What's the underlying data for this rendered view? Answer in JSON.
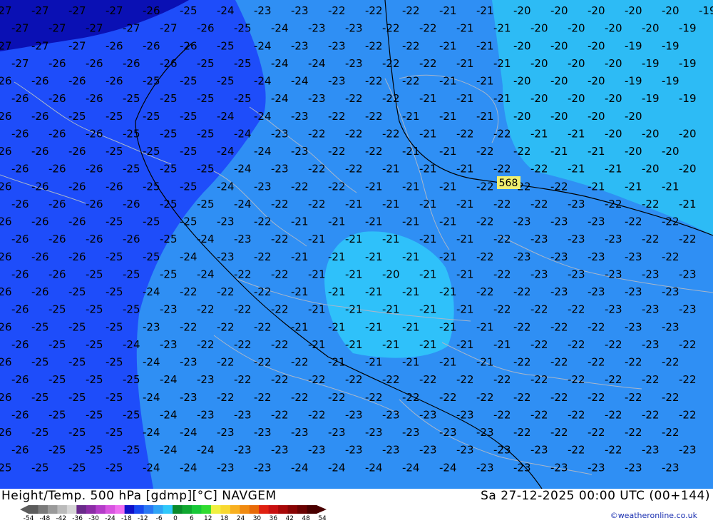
{
  "map": {
    "marker_label": "568",
    "colors": {
      "region_dark": "#0a10b4",
      "region_mid": "#1e4dfa",
      "region_main": "#2f8ff4",
      "region_light": "#2fc1fa",
      "region_light_right": "#2dbbf5",
      "contour": "#000000",
      "border": "#a9b6c9",
      "marker_bg": "#f0f070"
    },
    "temperature_rows": [
      [
        "-27",
        "-27",
        "-27",
        "-27",
        "-26",
        "-25",
        "-24",
        "-23",
        "-23",
        "-22",
        "-22",
        "-22",
        "-21",
        "-21",
        "-20",
        "-20",
        "-20",
        "-20",
        "-20",
        "-19",
        "-19"
      ],
      [
        "-27",
        "-27",
        "-27",
        "-27",
        "-27",
        "-26",
        "-25",
        "-24",
        "-23",
        "-23",
        "-22",
        "-22",
        "-21",
        "-21",
        "-20",
        "-20",
        "-20",
        "-20",
        "-19",
        "-19"
      ],
      [
        "-27",
        "-27",
        "-27",
        "-26",
        "-26",
        "-26",
        "-25",
        "-24",
        "-23",
        "-23",
        "-22",
        "-22",
        "-21",
        "-21",
        "-20",
        "-20",
        "-20",
        "-19",
        "-19"
      ],
      [
        "-27",
        "-26",
        "-26",
        "-26",
        "-26",
        "-25",
        "-25",
        "-24",
        "-24",
        "-23",
        "-22",
        "-22",
        "-21",
        "-21",
        "-20",
        "-20",
        "-20",
        "-19",
        "-19"
      ],
      [
        "-26",
        "-26",
        "-26",
        "-26",
        "-25",
        "-25",
        "-25",
        "-24",
        "-24",
        "-23",
        "-22",
        "-22",
        "-21",
        "-21",
        "-20",
        "-20",
        "-20",
        "-19",
        "-19"
      ],
      [
        "-26",
        "-26",
        "-26",
        "-25",
        "-25",
        "-25",
        "-25",
        "-24",
        "-23",
        "-22",
        "-22",
        "-21",
        "-21",
        "-21",
        "-20",
        "-20",
        "-20",
        "-19",
        "-19"
      ],
      [
        "-26",
        "-26",
        "-25",
        "-25",
        "-25",
        "-25",
        "-24",
        "-24",
        "-23",
        "-22",
        "-22",
        "-21",
        "-21",
        "-21",
        "-20",
        "-20",
        "-20",
        "-20"
      ],
      [
        "-26",
        "-26",
        "-26",
        "-25",
        "-25",
        "-25",
        "-24",
        "-23",
        "-22",
        "-22",
        "-22",
        "-21",
        "-22",
        "-22",
        "-21",
        "-21",
        "-20",
        "-20",
        "-20"
      ],
      [
        "-26",
        "-26",
        "-26",
        "-25",
        "-25",
        "-25",
        "-24",
        "-24",
        "-23",
        "-22",
        "-22",
        "-21",
        "-21",
        "-22",
        "-22",
        "-21",
        "-21",
        "-20",
        "-20"
      ],
      [
        "-26",
        "-26",
        "-26",
        "-25",
        "-25",
        "-25",
        "-24",
        "-23",
        "-22",
        "-22",
        "-21",
        "-21",
        "-21",
        "-22",
        "-22",
        "-21",
        "-21",
        "-20",
        "-20"
      ],
      [
        "-26",
        "-26",
        "-26",
        "-26",
        "-25",
        "-25",
        "-24",
        "-23",
        "-22",
        "-22",
        "-21",
        "-21",
        "-21",
        "-22",
        "-22",
        "-22",
        "-21",
        "-21",
        "-21"
      ],
      [
        "-26",
        "-26",
        "-26",
        "-26",
        "-25",
        "-25",
        "-24",
        "-22",
        "-22",
        "-21",
        "-21",
        "-21",
        "-21",
        "-22",
        "-22",
        "-23",
        "-22",
        "-22",
        "-21"
      ],
      [
        "-26",
        "-26",
        "-26",
        "-25",
        "-25",
        "-25",
        "-23",
        "-22",
        "-21",
        "-21",
        "-21",
        "-21",
        "-21",
        "-22",
        "-23",
        "-23",
        "-23",
        "-22",
        "-22"
      ],
      [
        "-26",
        "-26",
        "-26",
        "-26",
        "-25",
        "-24",
        "-23",
        "-22",
        "-21",
        "-21",
        "-21",
        "-21",
        "-21",
        "-22",
        "-23",
        "-23",
        "-23",
        "-22",
        "-22"
      ],
      [
        "-26",
        "-26",
        "-26",
        "-25",
        "-25",
        "-24",
        "-23",
        "-22",
        "-21",
        "-21",
        "-21",
        "-21",
        "-21",
        "-22",
        "-23",
        "-23",
        "-23",
        "-23",
        "-22"
      ],
      [
        "-26",
        "-26",
        "-25",
        "-25",
        "-25",
        "-24",
        "-22",
        "-22",
        "-21",
        "-21",
        "-20",
        "-21",
        "-21",
        "-22",
        "-23",
        "-23",
        "-23",
        "-23",
        "-23"
      ],
      [
        "-26",
        "-26",
        "-25",
        "-25",
        "-24",
        "-22",
        "-22",
        "-22",
        "-21",
        "-21",
        "-21",
        "-21",
        "-21",
        "-22",
        "-22",
        "-23",
        "-23",
        "-23",
        "-23"
      ],
      [
        "-26",
        "-25",
        "-25",
        "-25",
        "-23",
        "-22",
        "-22",
        "-22",
        "-21",
        "-21",
        "-21",
        "-21",
        "-21",
        "-22",
        "-22",
        "-22",
        "-23",
        "-23",
        "-23"
      ],
      [
        "-26",
        "-25",
        "-25",
        "-25",
        "-23",
        "-22",
        "-22",
        "-22",
        "-21",
        "-21",
        "-21",
        "-21",
        "-21",
        "-21",
        "-22",
        "-22",
        "-22",
        "-23",
        "-23"
      ],
      [
        "-26",
        "-25",
        "-25",
        "-24",
        "-23",
        "-22",
        "-22",
        "-22",
        "-21",
        "-21",
        "-21",
        "-21",
        "-21",
        "-21",
        "-22",
        "-22",
        "-22",
        "-23",
        "-22"
      ],
      [
        "-26",
        "-25",
        "-25",
        "-25",
        "-24",
        "-23",
        "-22",
        "-22",
        "-22",
        "-21",
        "-21",
        "-21",
        "-21",
        "-21",
        "-22",
        "-22",
        "-22",
        "-22",
        "-22"
      ],
      [
        "-26",
        "-25",
        "-25",
        "-25",
        "-24",
        "-23",
        "-22",
        "-22",
        "-22",
        "-22",
        "-22",
        "-22",
        "-22",
        "-22",
        "-22",
        "-22",
        "-22",
        "-22",
        "-22"
      ],
      [
        "-26",
        "-25",
        "-25",
        "-25",
        "-24",
        "-23",
        "-22",
        "-22",
        "-22",
        "-22",
        "-22",
        "-22",
        "-22",
        "-22",
        "-22",
        "-22",
        "-22",
        "-22",
        "-22"
      ],
      [
        "-26",
        "-25",
        "-25",
        "-25",
        "-24",
        "-23",
        "-23",
        "-22",
        "-22",
        "-23",
        "-23",
        "-23",
        "-23",
        "-22",
        "-22",
        "-22",
        "-22",
        "-22",
        "-22"
      ],
      [
        "-26",
        "-25",
        "-25",
        "-25",
        "-24",
        "-24",
        "-23",
        "-23",
        "-23",
        "-23",
        "-23",
        "-23",
        "-23",
        "-23",
        "-22",
        "-22",
        "-22",
        "-22",
        "-22"
      ],
      [
        "-26",
        "-25",
        "-25",
        "-25",
        "-24",
        "-24",
        "-23",
        "-23",
        "-23",
        "-23",
        "-23",
        "-23",
        "-23",
        "-23",
        "-23",
        "-22",
        "-22",
        "-23",
        "-23"
      ],
      [
        "-25",
        "-25",
        "-25",
        "-25",
        "-24",
        "-24",
        "-23",
        "-23",
        "-24",
        "-24",
        "-24",
        "-24",
        "-24",
        "-23",
        "-23",
        "-23",
        "-23",
        "-23",
        "-23"
      ]
    ]
  },
  "footer": {
    "title_left": "Height/Temp. 500 hPa [gdmp][°C] NAVGEM",
    "title_right": "Sa 27-12-2025 00:00 UTC (00+144)",
    "credit": "©weatheronline.co.uk",
    "scale_labels": [
      "-54",
      "-48",
      "-42",
      "-36",
      "-30",
      "-24",
      "-18",
      "-12",
      "-6",
      "0",
      "6",
      "12",
      "18",
      "24",
      "30",
      "36",
      "42",
      "48",
      "54"
    ],
    "scale_colors": [
      "#5c5c5c",
      "#7a7a7a",
      "#9a9a9a",
      "#bababa",
      "#d6d6d6",
      "#6a2a8a",
      "#8c2ca6",
      "#b43cc8",
      "#d854e0",
      "#f070f0",
      "#1010c8",
      "#1848f0",
      "#2a78f4",
      "#2fa4f6",
      "#30c8fa",
      "#0a8a2a",
      "#10a830",
      "#18c838",
      "#30dc30",
      "#f0f040",
      "#f8d830",
      "#f8b020",
      "#f08a10",
      "#e86a08",
      "#e02010",
      "#c81010",
      "#a80808",
      "#880404",
      "#6a0202",
      "#4a0000"
    ]
  }
}
